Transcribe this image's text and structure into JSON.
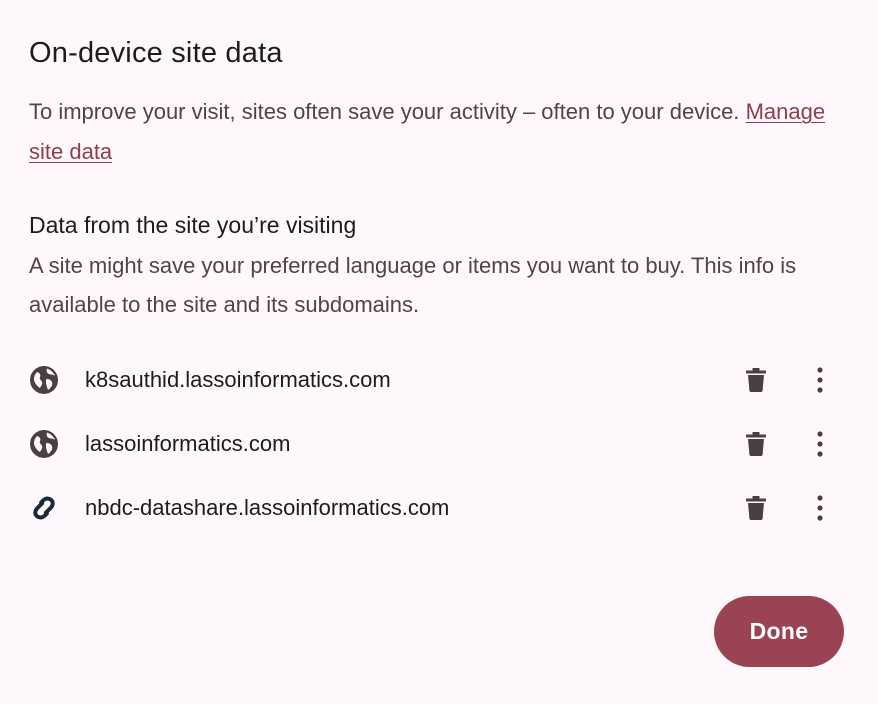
{
  "dialog": {
    "title": "On-device site data",
    "intro_text": "To improve your visit, sites often save your activity – often to your device.",
    "manage_link": "Manage site data",
    "section_heading": "Data from the site you’re visiting",
    "section_description": "A site might save your preferred language or items you want to buy. This info is available to the site and its subdomains.",
    "sites": [
      {
        "name": "k8sauthid.lassoinformatics.com",
        "icon": "globe-icon"
      },
      {
        "name": "lassoinformatics.com",
        "icon": "globe-icon"
      },
      {
        "name": "nbdc-datashare.lassoinformatics.com",
        "icon": "site-logo-icon"
      }
    ],
    "done_label": "Done"
  },
  "colors": {
    "background": "#fef8fc",
    "accent": "#9a4352",
    "link": "#8f3d4b",
    "primary_text": "#211a1c",
    "secondary_text": "#514347",
    "icon": "#4a3f42"
  }
}
